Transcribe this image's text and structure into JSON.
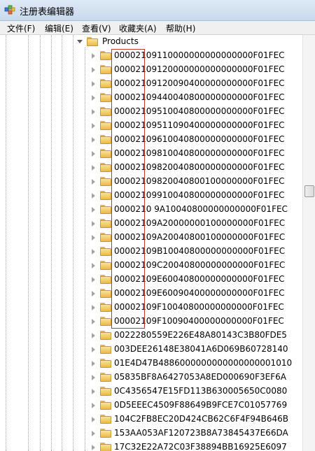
{
  "window": {
    "title": "注册表编辑器",
    "icon": "registry-editor-icon"
  },
  "menu": [
    {
      "label": "文件(F)"
    },
    {
      "label": "编辑(E)"
    },
    {
      "label": "查看(V)"
    },
    {
      "label": "收藏夹(A)"
    },
    {
      "label": "帮助(H)"
    }
  ],
  "tree": {
    "parent": {
      "label": "Products",
      "expanded": true
    },
    "children": [
      "00002109110000000000000000F01FEC",
      "00002109120000000000000000F01FEC",
      "00002109120090400000000000F01FEC",
      "00002109440040800000000000F01FEC",
      "00002109510040800000000000F01FEC",
      "00002109511090400000000000F01FEC",
      "00002109610040800000000000F01FEC",
      "00002109810040800000000000F01FEC",
      "00002109820040800000000000F01FEC",
      "00002109820040800100000000F01FEC",
      "00002109910040800000000000F01FEC",
      "0000210 9A10040800000000000F01FEC",
      "00002109A20000000100000000F01FEC",
      "00002109A20040800100000000F01FEC",
      "00002109B10040800000000000F01FEC",
      "00002109C20040800000000000F01FEC",
      "00002109E60040800000000000F01FEC",
      "00002109E60090400000000000F01FEC",
      "00002109F10040800000000000F01FEC",
      "00002109F10090400000000000F01FEC",
      "0022280559E226E48A80143C3B80FDE5",
      "003DEE26148E38041A6D069B60728140",
      "01E4D47B4886000000000000000001010",
      "05835BF8A6427053A8ED000690F3EF6A",
      "0C4356547E15FD113B630005650C0080",
      "0D5EEEC4509F88649B9FCE7C01057769",
      "104C2FB8EC20D424CB62C6F4F94B646B",
      "153AA053AF120723B8A73845437E66DA",
      "17C32E22A72C03F38894BB16925E6097"
    ]
  },
  "highlight": {
    "color": "#c0392b"
  }
}
